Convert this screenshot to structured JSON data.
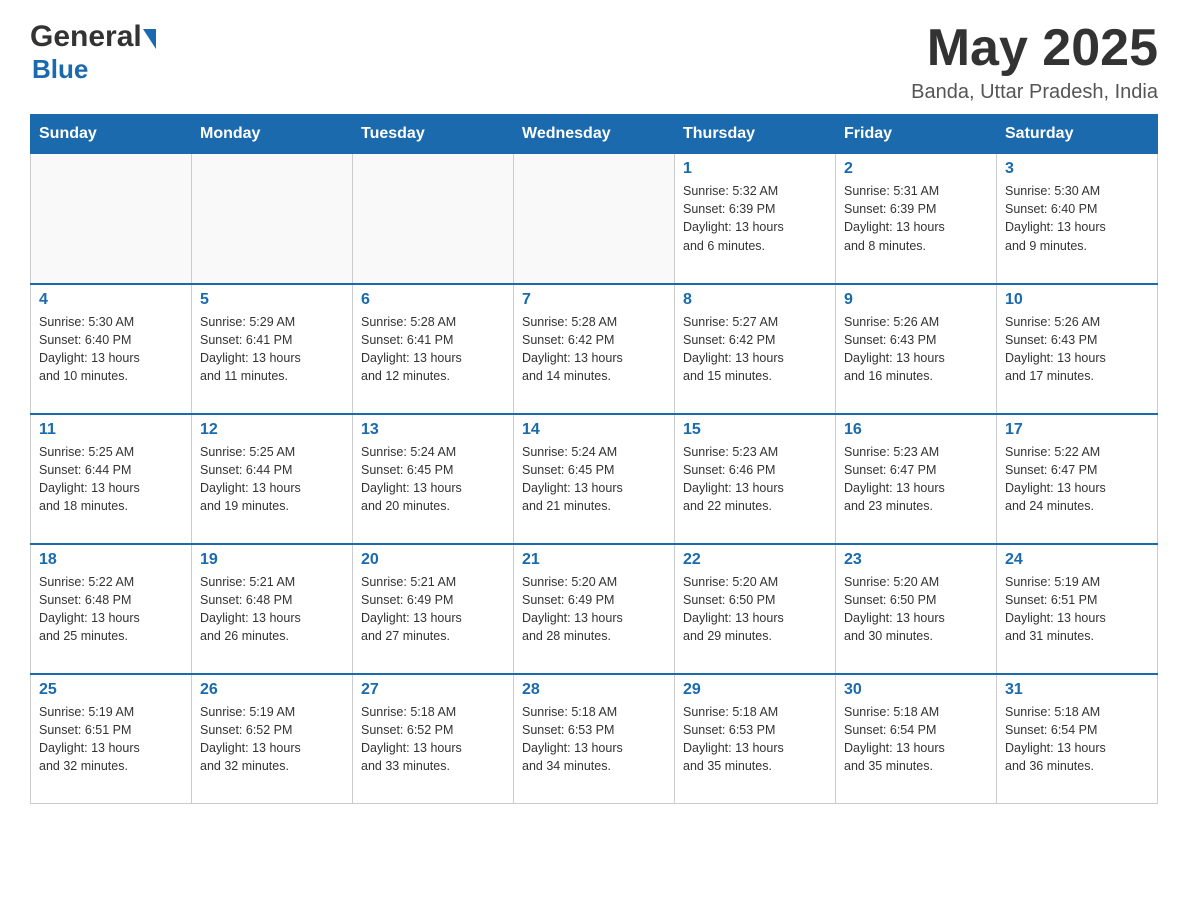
{
  "header": {
    "month_year": "May 2025",
    "location": "Banda, Uttar Pradesh, India",
    "logo_general": "General",
    "logo_blue": "Blue"
  },
  "days_of_week": [
    "Sunday",
    "Monday",
    "Tuesday",
    "Wednesday",
    "Thursday",
    "Friday",
    "Saturday"
  ],
  "weeks": [
    {
      "days": [
        {
          "number": "",
          "info": ""
        },
        {
          "number": "",
          "info": ""
        },
        {
          "number": "",
          "info": ""
        },
        {
          "number": "",
          "info": ""
        },
        {
          "number": "1",
          "info": "Sunrise: 5:32 AM\nSunset: 6:39 PM\nDaylight: 13 hours\nand 6 minutes."
        },
        {
          "number": "2",
          "info": "Sunrise: 5:31 AM\nSunset: 6:39 PM\nDaylight: 13 hours\nand 8 minutes."
        },
        {
          "number": "3",
          "info": "Sunrise: 5:30 AM\nSunset: 6:40 PM\nDaylight: 13 hours\nand 9 minutes."
        }
      ]
    },
    {
      "days": [
        {
          "number": "4",
          "info": "Sunrise: 5:30 AM\nSunset: 6:40 PM\nDaylight: 13 hours\nand 10 minutes."
        },
        {
          "number": "5",
          "info": "Sunrise: 5:29 AM\nSunset: 6:41 PM\nDaylight: 13 hours\nand 11 minutes."
        },
        {
          "number": "6",
          "info": "Sunrise: 5:28 AM\nSunset: 6:41 PM\nDaylight: 13 hours\nand 12 minutes."
        },
        {
          "number": "7",
          "info": "Sunrise: 5:28 AM\nSunset: 6:42 PM\nDaylight: 13 hours\nand 14 minutes."
        },
        {
          "number": "8",
          "info": "Sunrise: 5:27 AM\nSunset: 6:42 PM\nDaylight: 13 hours\nand 15 minutes."
        },
        {
          "number": "9",
          "info": "Sunrise: 5:26 AM\nSunset: 6:43 PM\nDaylight: 13 hours\nand 16 minutes."
        },
        {
          "number": "10",
          "info": "Sunrise: 5:26 AM\nSunset: 6:43 PM\nDaylight: 13 hours\nand 17 minutes."
        }
      ]
    },
    {
      "days": [
        {
          "number": "11",
          "info": "Sunrise: 5:25 AM\nSunset: 6:44 PM\nDaylight: 13 hours\nand 18 minutes."
        },
        {
          "number": "12",
          "info": "Sunrise: 5:25 AM\nSunset: 6:44 PM\nDaylight: 13 hours\nand 19 minutes."
        },
        {
          "number": "13",
          "info": "Sunrise: 5:24 AM\nSunset: 6:45 PM\nDaylight: 13 hours\nand 20 minutes."
        },
        {
          "number": "14",
          "info": "Sunrise: 5:24 AM\nSunset: 6:45 PM\nDaylight: 13 hours\nand 21 minutes."
        },
        {
          "number": "15",
          "info": "Sunrise: 5:23 AM\nSunset: 6:46 PM\nDaylight: 13 hours\nand 22 minutes."
        },
        {
          "number": "16",
          "info": "Sunrise: 5:23 AM\nSunset: 6:47 PM\nDaylight: 13 hours\nand 23 minutes."
        },
        {
          "number": "17",
          "info": "Sunrise: 5:22 AM\nSunset: 6:47 PM\nDaylight: 13 hours\nand 24 minutes."
        }
      ]
    },
    {
      "days": [
        {
          "number": "18",
          "info": "Sunrise: 5:22 AM\nSunset: 6:48 PM\nDaylight: 13 hours\nand 25 minutes."
        },
        {
          "number": "19",
          "info": "Sunrise: 5:21 AM\nSunset: 6:48 PM\nDaylight: 13 hours\nand 26 minutes."
        },
        {
          "number": "20",
          "info": "Sunrise: 5:21 AM\nSunset: 6:49 PM\nDaylight: 13 hours\nand 27 minutes."
        },
        {
          "number": "21",
          "info": "Sunrise: 5:20 AM\nSunset: 6:49 PM\nDaylight: 13 hours\nand 28 minutes."
        },
        {
          "number": "22",
          "info": "Sunrise: 5:20 AM\nSunset: 6:50 PM\nDaylight: 13 hours\nand 29 minutes."
        },
        {
          "number": "23",
          "info": "Sunrise: 5:20 AM\nSunset: 6:50 PM\nDaylight: 13 hours\nand 30 minutes."
        },
        {
          "number": "24",
          "info": "Sunrise: 5:19 AM\nSunset: 6:51 PM\nDaylight: 13 hours\nand 31 minutes."
        }
      ]
    },
    {
      "days": [
        {
          "number": "25",
          "info": "Sunrise: 5:19 AM\nSunset: 6:51 PM\nDaylight: 13 hours\nand 32 minutes."
        },
        {
          "number": "26",
          "info": "Sunrise: 5:19 AM\nSunset: 6:52 PM\nDaylight: 13 hours\nand 32 minutes."
        },
        {
          "number": "27",
          "info": "Sunrise: 5:18 AM\nSunset: 6:52 PM\nDaylight: 13 hours\nand 33 minutes."
        },
        {
          "number": "28",
          "info": "Sunrise: 5:18 AM\nSunset: 6:53 PM\nDaylight: 13 hours\nand 34 minutes."
        },
        {
          "number": "29",
          "info": "Sunrise: 5:18 AM\nSunset: 6:53 PM\nDaylight: 13 hours\nand 35 minutes."
        },
        {
          "number": "30",
          "info": "Sunrise: 5:18 AM\nSunset: 6:54 PM\nDaylight: 13 hours\nand 35 minutes."
        },
        {
          "number": "31",
          "info": "Sunrise: 5:18 AM\nSunset: 6:54 PM\nDaylight: 13 hours\nand 36 minutes."
        }
      ]
    }
  ]
}
